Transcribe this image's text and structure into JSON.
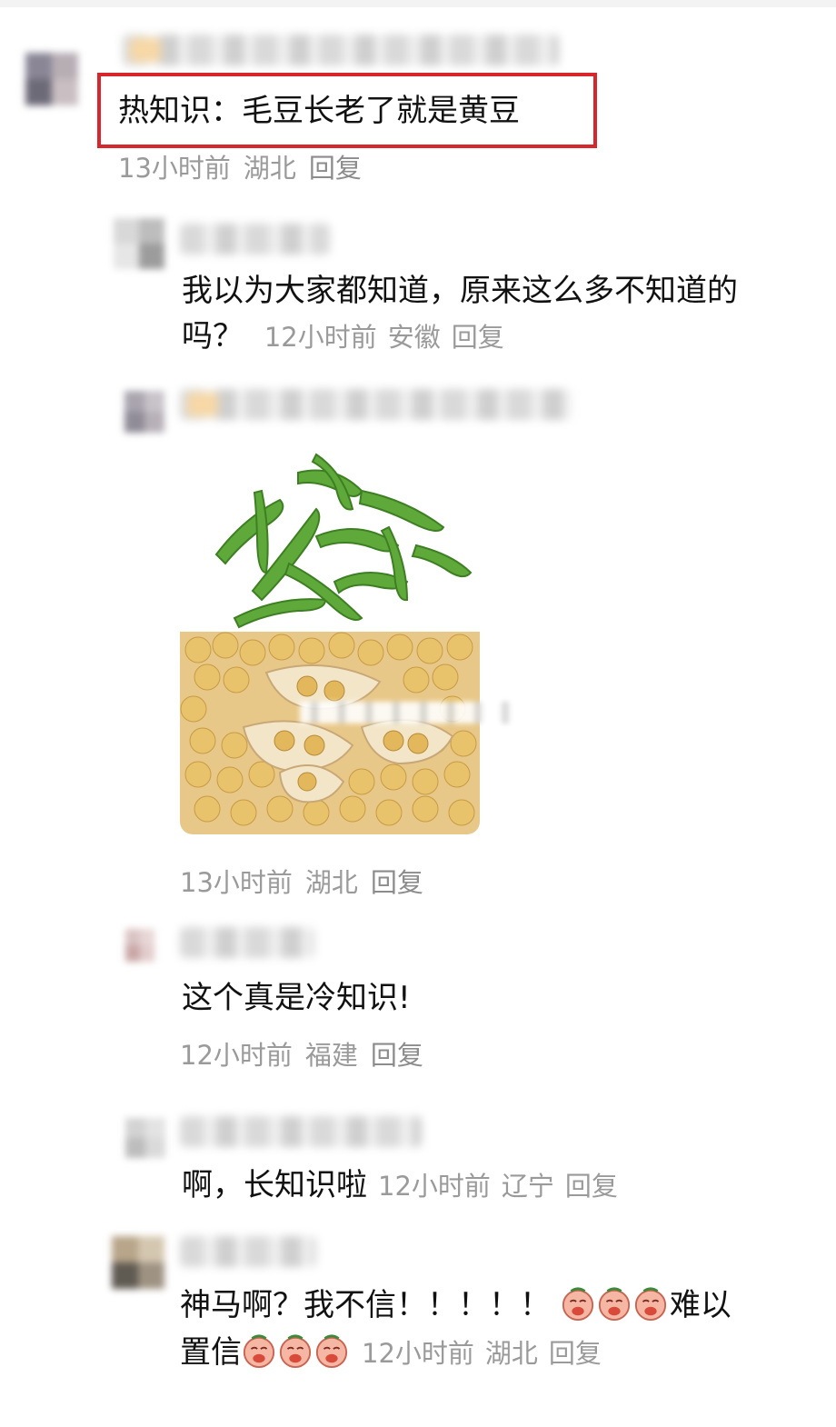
{
  "comments": [
    {
      "text": "热知识：毛豆长老了就是黄豆",
      "time": "13小时前",
      "location": "湖北",
      "reply": "回复"
    },
    {
      "text_line1": "我以为大家都知道，原来这么多不知道的",
      "text_line2": "吗？",
      "time": "12小时前",
      "location": "安徽",
      "reply": "回复"
    },
    {
      "image_icon": "edamame-soybean-photo",
      "time": "13小时前",
      "location": "湖北",
      "reply": "回复"
    },
    {
      "text": "这个真是冷知识!",
      "time": "12小时前",
      "location": "福建",
      "reply": "回复"
    },
    {
      "text": "啊，长知识啦",
      "time": "12小时前",
      "location": "辽宁",
      "reply": "回复"
    },
    {
      "text_part1": "神马啊？我不信！！！！！",
      "text_part2": "难以",
      "text_part3": "置信",
      "emoji_icon": "crying-face-icon",
      "time": "12小时前",
      "location": "湖北",
      "reply": "回复"
    }
  ],
  "colors": {
    "highlight_border": "#d8272c",
    "meta_text": "#9a9a9a"
  }
}
